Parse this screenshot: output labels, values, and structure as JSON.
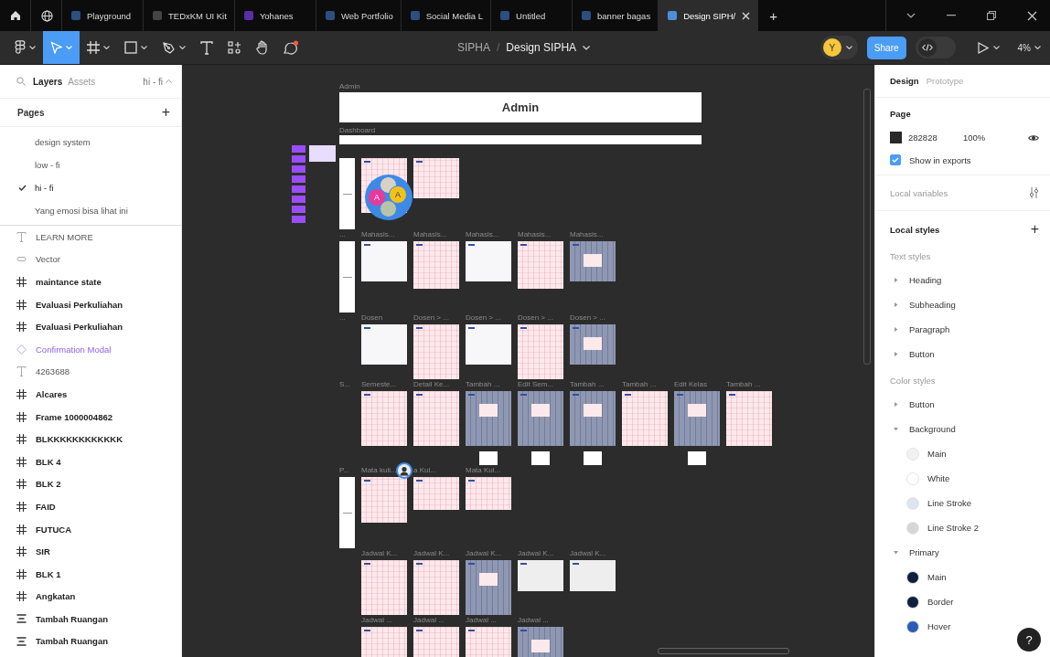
{
  "tabs": [
    {
      "label": "Playground",
      "color": "#2b4f80",
      "selected": false,
      "closable": false
    },
    {
      "label": "TEDxKM UI Kit",
      "color": "#444444",
      "selected": false,
      "closable": false
    },
    {
      "label": "Yohanes",
      "color": "#5a2ea6",
      "selected": false,
      "closable": false
    },
    {
      "label": "Web Portfolio",
      "color": "#2b4f80",
      "selected": false,
      "closable": false
    },
    {
      "label": "Social Media L",
      "color": "#2b4f80",
      "selected": false,
      "closable": false
    },
    {
      "label": "Untitled",
      "color": "#2b4f80",
      "selected": false,
      "closable": false
    },
    {
      "label": "banner bagas",
      "color": "#2b4f80",
      "selected": false,
      "closable": false
    },
    {
      "label": "Design SIPH/",
      "color": "#4b8fd8",
      "selected": true,
      "closable": true
    }
  ],
  "dev_mode": false,
  "new_tab": "+",
  "toolbar": {
    "tools": [
      {
        "kind": "logo",
        "selected": false
      },
      {
        "kind": "move",
        "selected": true
      },
      {
        "kind": "frame",
        "selected": false
      },
      {
        "kind": "shape",
        "selected": false
      },
      {
        "kind": "pen",
        "selected": false
      },
      {
        "kind": "text",
        "selected": false
      },
      {
        "kind": "resources",
        "selected": false
      },
      {
        "kind": "hand",
        "selected": false
      },
      {
        "kind": "comment",
        "selected": false
      }
    ],
    "project": "SIPHA",
    "separator": "/",
    "file": "Design SIPHA",
    "user_initial": "Y",
    "share": "Share",
    "zoom": "4%"
  },
  "left_panel": {
    "tabs": [
      {
        "label": "Layers",
        "selected": true
      },
      {
        "label": "Assets",
        "selected": false
      }
    ],
    "page_switch": "hi - fi",
    "pages_title": "Pages",
    "add": "+",
    "pages": [
      {
        "label": "design system",
        "checked": false
      },
      {
        "label": "low - fi",
        "checked": false
      },
      {
        "label": "hi - fi",
        "checked": true
      },
      {
        "label": "Yang emosi bisa lihat ini",
        "checked": false
      }
    ],
    "layers": [
      {
        "kind": "text",
        "label": "LEARN MORE"
      },
      {
        "kind": "vector",
        "label": "Vector"
      },
      {
        "kind": "frame",
        "label": "maintance state"
      },
      {
        "kind": "frame",
        "label": "Evaluasi Perkuliahan"
      },
      {
        "kind": "frame",
        "label": "Evaluasi Perkuliahan"
      },
      {
        "kind": "component",
        "label": "Confirmation Modal"
      },
      {
        "kind": "text",
        "label": "4263688"
      },
      {
        "kind": "frame",
        "label": "Alcares"
      },
      {
        "kind": "frame",
        "label": "Frame 1000004862"
      },
      {
        "kind": "frame",
        "label": "BLKKKKKKKKKKKK"
      },
      {
        "kind": "frame",
        "label": "BLK 4"
      },
      {
        "kind": "frame",
        "label": "BLK 2"
      },
      {
        "kind": "frame",
        "label": "FAID"
      },
      {
        "kind": "frame",
        "label": "FUTUCA"
      },
      {
        "kind": "frame",
        "label": "SIR"
      },
      {
        "kind": "frame",
        "label": "BLK 1"
      },
      {
        "kind": "frame",
        "label": "Angkatan"
      },
      {
        "kind": "autolayout",
        "label": "Tambah Ruangan"
      },
      {
        "kind": "autolayout",
        "label": "Tambah Ruangan"
      }
    ]
  },
  "canvas": {
    "header": {
      "label": "Admin",
      "title": "Admin"
    },
    "dashboard": {
      "label": "Dashboard"
    },
    "collaborators": [
      {
        "initial": "A",
        "color": "#e8399c"
      },
      {
        "initial": "A",
        "color": "#f2c21b"
      }
    ],
    "rows": [
      {
        "frames": [
          {
            "kind": "pink",
            "tall": true
          },
          {
            "kind": "pink",
            "tall": false
          }
        ]
      },
      {
        "section": "...",
        "frames": [
          {
            "label": "Mahasis...",
            "kind": "white",
            "tall": false
          },
          {
            "label": "Mahasis...",
            "kind": "pink",
            "tall": true
          },
          {
            "label": "Mahasis...",
            "kind": "white",
            "tall": false
          },
          {
            "label": "Mahasis...",
            "kind": "pink",
            "tall": true
          },
          {
            "label": "Mahasis...",
            "kind": "overlay",
            "tall": false
          }
        ]
      },
      {
        "section": "...",
        "frames": [
          {
            "label": "Dosen",
            "kind": "white",
            "tall": false
          },
          {
            "label": "Dosen > ...",
            "kind": "pink",
            "tall": true
          },
          {
            "label": "Dosen > ...",
            "kind": "white",
            "tall": false
          },
          {
            "label": "Dosen > ...",
            "kind": "pink",
            "tall": true
          },
          {
            "label": "Dosen > ...",
            "kind": "overlay",
            "tall": false
          }
        ]
      },
      {
        "section": "S...",
        "frames": [
          {
            "label": "Semeste...",
            "kind": "pink",
            "tall": true
          },
          {
            "label": "Detail Ke...",
            "kind": "pink",
            "tall": true
          },
          {
            "label": "Tambah ...",
            "kind": "overlay",
            "tall": true
          },
          {
            "label": "Edit Sem...",
            "kind": "overlay",
            "tall": true
          },
          {
            "label": "Tambah ...",
            "kind": "overlay",
            "tall": true
          },
          {
            "label": "Tambah ...",
            "kind": "pink",
            "tall": true
          },
          {
            "label": "Edit Kelas",
            "kind": "overlay",
            "tall": true
          },
          {
            "label": "Tambah ...",
            "kind": "pink",
            "tall": true
          }
        ]
      },
      {
        "section": "P...",
        "frames": [
          {
            "label": "Mata kuli...",
            "kind": "pink",
            "tall": true
          },
          {
            "label": "a Kul...",
            "kind": "pink",
            "tall": false
          },
          {
            "label": "Mata Kul...",
            "kind": "pink",
            "tall": false
          }
        ]
      },
      {
        "frames": [
          {
            "label": "Jadwal K...",
            "kind": "pink",
            "tall": true
          },
          {
            "label": "Jadwal K...",
            "kind": "pink",
            "tall": true
          },
          {
            "label": "Jadwal K...",
            "kind": "overlay",
            "tall": true
          },
          {
            "label": "Jadwal K...",
            "kind": "dark",
            "tall": false
          },
          {
            "label": "Jadwal K...",
            "kind": "dark",
            "tall": false
          }
        ]
      },
      {
        "frames": [
          {
            "label": "Jadwal ...",
            "kind": "pink",
            "tall": true
          },
          {
            "label": "Jadwal ...",
            "kind": "pink",
            "tall": true
          },
          {
            "label": "Jadwal ...",
            "kind": "pink",
            "tall": true
          },
          {
            "label": "Jadwal ...",
            "kind": "overlay",
            "tall": true
          }
        ]
      }
    ]
  },
  "right_panel": {
    "tabs": [
      {
        "label": "Design",
        "selected": true
      },
      {
        "label": "Prototype",
        "selected": false
      }
    ],
    "page_title": "Page",
    "fill_hex": "282828",
    "opacity": "100%",
    "show_in_exports": {
      "label": "Show in exports",
      "checked": true
    },
    "local_variables": "Local variables",
    "local_styles": "Local styles",
    "add": "+",
    "text_styles_title": "Text styles",
    "text_styles": [
      {
        "label": "Heading",
        "expanded": false
      },
      {
        "label": "Subheading",
        "expanded": false
      },
      {
        "label": "Paragraph",
        "expanded": false
      },
      {
        "label": "Button",
        "expanded": false
      }
    ],
    "color_styles_title": "Color styles",
    "color_styles": [
      {
        "label": "Button",
        "expanded": false
      },
      {
        "label": "Background",
        "expanded": true,
        "children": [
          {
            "label": "Main",
            "color": "#f1f1f1"
          },
          {
            "label": "White",
            "color": "#ffffff"
          },
          {
            "label": "Line Stroke",
            "color": "#dde4ec"
          },
          {
            "label": "Line Stroke 2",
            "color": "#d6d6d6"
          }
        ]
      },
      {
        "label": "Primary",
        "expanded": true,
        "children": [
          {
            "label": "Main",
            "color": "#0e1f3f"
          },
          {
            "label": "Border",
            "color": "#11203f"
          },
          {
            "label": "Hover",
            "color": "#2b5db3"
          }
        ]
      }
    ],
    "help": "?"
  }
}
